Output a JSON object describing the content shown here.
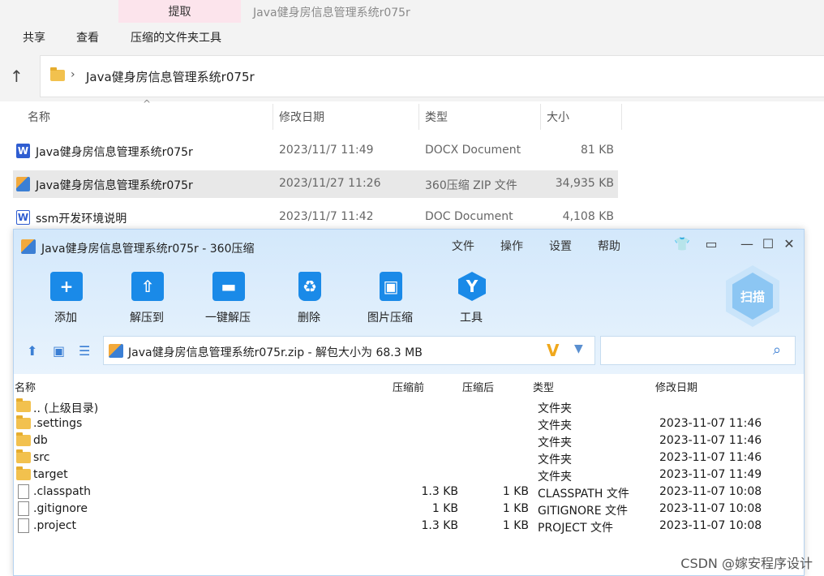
{
  "explorer": {
    "context_tab": "提取",
    "window_title": "Java健身房信息管理系统r075r",
    "ribbon_tabs": [
      "共享",
      "查看",
      "压缩的文件夹工具"
    ],
    "address": "Java健身房信息管理系统r075r",
    "columns": [
      "名称",
      "修改日期",
      "类型",
      "大小"
    ],
    "files": [
      {
        "name": "Java健身房信息管理系统r075r",
        "date": "2023/11/7 11:49",
        "type": "DOCX Document",
        "size": "81 KB",
        "icon": "wps-doc-icon"
      },
      {
        "name": "Java健身房信息管理系统r075r",
        "date": "2023/11/27 11:26",
        "type": "360压缩 ZIP 文件",
        "size": "34,935 KB",
        "icon": "zip-archive-icon"
      },
      {
        "name": "ssm开发环境说明",
        "date": "2023/11/7 11:42",
        "type": "DOC Document",
        "size": "4,108 KB",
        "icon": "word-doc-icon"
      }
    ]
  },
  "zip": {
    "title": "Java健身房信息管理系统r075r - 360压缩",
    "menu": [
      "文件",
      "操作",
      "设置",
      "帮助"
    ],
    "tools": [
      "添加",
      "解压到",
      "一键解压",
      "删除",
      "图片压缩",
      "工具"
    ],
    "scan": "扫描",
    "path": "Java健身房信息管理系统r075r.zip - 解包大小为 68.3 MB",
    "columns": [
      "名称",
      "压缩前",
      "压缩后",
      "类型",
      "修改日期"
    ],
    "rows": [
      {
        "name": ".. (上级目录)",
        "before": "",
        "after": "",
        "type": "文件夹",
        "date": "",
        "kind": "folder"
      },
      {
        "name": ".settings",
        "before": "",
        "after": "",
        "type": "文件夹",
        "date": "2023-11-07 11:46",
        "kind": "folder"
      },
      {
        "name": "db",
        "before": "",
        "after": "",
        "type": "文件夹",
        "date": "2023-11-07 11:46",
        "kind": "folder"
      },
      {
        "name": "src",
        "before": "",
        "after": "",
        "type": "文件夹",
        "date": "2023-11-07 11:46",
        "kind": "folder"
      },
      {
        "name": "target",
        "before": "",
        "after": "",
        "type": "文件夹",
        "date": "2023-11-07 11:49",
        "kind": "folder"
      },
      {
        "name": ".classpath",
        "before": "1.3 KB",
        "after": "1 KB",
        "type": "CLASSPATH 文件",
        "date": "2023-11-07 10:08",
        "kind": "file"
      },
      {
        "name": ".gitignore",
        "before": "1 KB",
        "after": "1 KB",
        "type": "GITIGNORE 文件",
        "date": "2023-11-07 10:08",
        "kind": "file"
      },
      {
        "name": ".project",
        "before": "1.3 KB",
        "after": "1 KB",
        "type": "PROJECT 文件",
        "date": "2023-11-07 10:08",
        "kind": "file"
      }
    ]
  },
  "watermark": "CSDN @嫁安程序设计"
}
